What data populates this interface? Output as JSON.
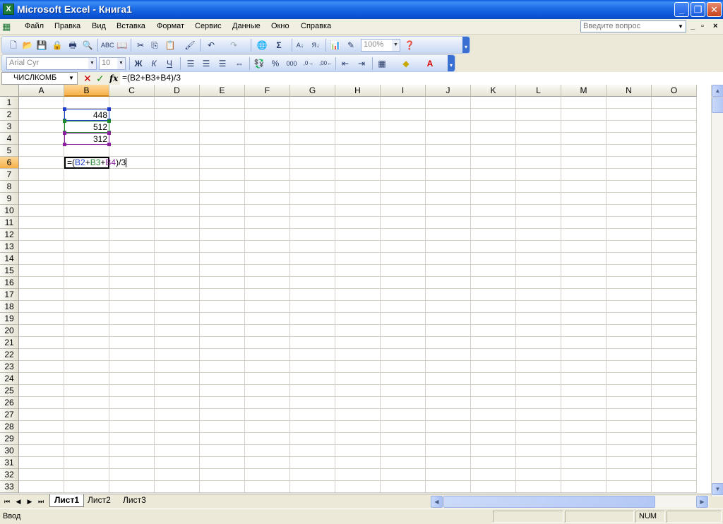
{
  "window": {
    "title": "Microsoft Excel - Книга1",
    "app_icon": "excel-icon",
    "controls": [
      "minimize",
      "maximize",
      "close"
    ]
  },
  "menu": {
    "items": [
      "Файл",
      "Правка",
      "Вид",
      "Вставка",
      "Формат",
      "Сервис",
      "Данные",
      "Окно",
      "Справка"
    ],
    "help_placeholder": "Введите вопрос",
    "doc_controls": [
      "_",
      "▫",
      "×"
    ]
  },
  "standard_toolbar": {
    "zoom": "100%",
    "icons": [
      "new-icon",
      "open-icon",
      "save-icon",
      "permission-icon",
      "print-icon",
      "print-preview-icon",
      "spelling-icon",
      "research-icon",
      "cut-icon",
      "copy-icon",
      "paste-icon",
      "format-painter-icon",
      "undo-icon",
      "redo-icon",
      "hyperlink-icon",
      "autosum-icon",
      "sort-asc-icon",
      "sort-desc-icon",
      "chart-wizard-icon",
      "drawing-icon",
      "help-icon"
    ]
  },
  "formatting_toolbar": {
    "font": "Arial Cyr",
    "size": "10",
    "bold_label": "Ж",
    "italic_label": "К",
    "underline_label": "Ч",
    "icons": [
      "align-left-icon",
      "align-center-icon",
      "align-right-icon",
      "merge-center-icon",
      "currency-icon",
      "percent-icon",
      "comma-icon",
      "increase-decimal-icon",
      "decrease-decimal-icon",
      "decrease-indent-icon",
      "increase-indent-icon",
      "borders-icon",
      "fill-color-icon",
      "font-color-icon"
    ]
  },
  "formula_bar": {
    "name_box": "ЧИСЛКОМБ",
    "fx_label": "fx",
    "formula": "=(B2+B3+B4)/3"
  },
  "grid": {
    "columns": [
      "A",
      "B",
      "C",
      "D",
      "E",
      "F",
      "G",
      "H",
      "I",
      "J",
      "K",
      "L",
      "M",
      "N",
      "O"
    ],
    "rows": [
      "1",
      "2",
      "3",
      "4",
      "5",
      "6",
      "7",
      "8",
      "9",
      "10",
      "11",
      "12",
      "13",
      "14",
      "15",
      "16",
      "17",
      "18",
      "19",
      "20",
      "21",
      "22",
      "23",
      "24",
      "25",
      "26",
      "27",
      "28",
      "29",
      "30",
      "31",
      "32",
      "33"
    ],
    "selected_column": "B",
    "selected_row": "6",
    "cells": {
      "B2": "448",
      "B3": "512",
      "B4": "312",
      "B6": {
        "parts": [
          "=(",
          "B2",
          "+",
          "B3",
          "+",
          "B4",
          ")/3"
        ]
      }
    },
    "ref_colors": {
      "B2": "#1f3cc9",
      "B3": "#1d8a2e",
      "B4": "#8a1fa0"
    }
  },
  "sheets": {
    "tabs": [
      "Лист1",
      "Лист2",
      "Лист3"
    ],
    "active": "Лист1"
  },
  "status": {
    "mode": "Ввод",
    "num": "NUM"
  }
}
